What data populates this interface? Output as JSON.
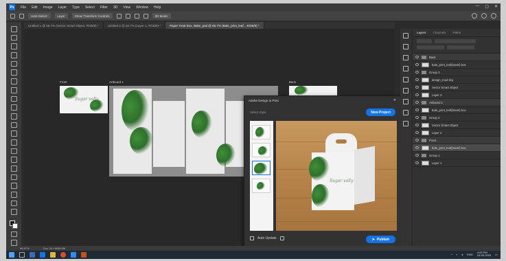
{
  "app": {
    "logo": "Ps",
    "menu": [
      "File",
      "Edit",
      "Image",
      "Layer",
      "Type",
      "Select",
      "Filter",
      "3D",
      "View",
      "Window",
      "Help"
    ],
    "window_controls": [
      "—",
      "▢",
      "✕"
    ]
  },
  "options_bar": {
    "auto_select_label": "Auto-Select:",
    "auto_select_value": "Layer",
    "show_transform": "Show Transform Controls",
    "mode_label": "3D Mode:"
  },
  "tabs": [
    {
      "label": "Untitled-1 @ 66.7% (Vector Smart Object, RGB/8) *",
      "active": false
    },
    {
      "label": "Untitled-2 @ 66.7% (Layer 1, RGB/8) *",
      "active": false
    },
    {
      "label": "Paper Treat Box, Bake_psd @ 66.7% (Bale_print_leaf...,RGB/8) *",
      "active": true
    }
  ],
  "artboards": [
    {
      "label": "Front"
    },
    {
      "label": "Artboard 1"
    },
    {
      "label": "Back"
    }
  ],
  "artwork": {
    "signature": "Sugar vally"
  },
  "status": {
    "zoom": "66.67%",
    "doc": "Doc: 59.1M/68.6M"
  },
  "dialog": {
    "title": "Adobe Design to Print",
    "close": "✕",
    "subtitle": "Select Style",
    "new_project": "New Project",
    "auto_update": "Auto Update",
    "publish": "Publish",
    "publish_icon": "send-icon"
  },
  "panel": {
    "tabs": [
      "Layers",
      "Channels",
      "Paths"
    ],
    "active_tab": "Layers",
    "layers": [
      {
        "name": "Back",
        "kind": "group"
      },
      {
        "name": "bale_print_leaf(travel) box",
        "kind": "layer"
      },
      {
        "name": "Group 3",
        "kind": "folder"
      },
      {
        "name": "design_mod.tiny",
        "kind": "layer"
      },
      {
        "name": "Vector Smart Object",
        "kind": "layer"
      },
      {
        "name": "Layer 3",
        "kind": "layer"
      },
      {
        "name": "Artboard 1",
        "kind": "group"
      },
      {
        "name": "bale_print_leaf(travel) box",
        "kind": "layer"
      },
      {
        "name": "Group 2",
        "kind": "folder"
      },
      {
        "name": "Vector Smart Object",
        "kind": "layer"
      },
      {
        "name": "Layer 2",
        "kind": "layer"
      },
      {
        "name": "Front",
        "kind": "group"
      },
      {
        "name": "bale_print_leaf(travel) box",
        "kind": "selected"
      },
      {
        "name": "Group 1",
        "kind": "folder"
      },
      {
        "name": "Layer 1",
        "kind": "layer"
      }
    ]
  },
  "taskbar": {
    "time": "4:03 PM",
    "date": "24-05-2020",
    "lang": "ENG"
  },
  "colors": {
    "accent": "#1473e6",
    "ui_dark": "#2b2b2b",
    "leaf_green": "#3f8f3a",
    "wood": "#b48148"
  }
}
